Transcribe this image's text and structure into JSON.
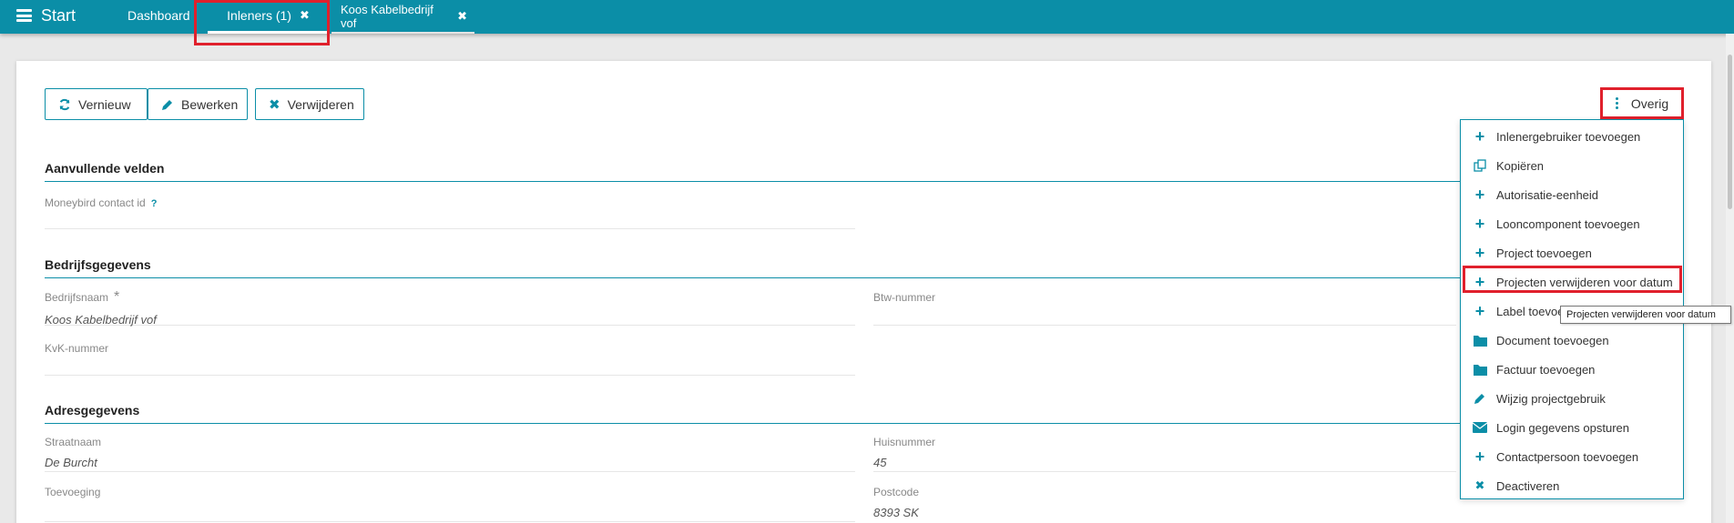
{
  "topbar": {
    "start_label": "Start",
    "tabs": [
      {
        "label": "Dashboard"
      },
      {
        "label": "Inleners (1)"
      },
      {
        "label": "Koos Kabelbedrijf vof"
      }
    ]
  },
  "toolbar": {
    "refresh_label": "Vernieuw",
    "edit_label": "Bewerken",
    "delete_label": "Verwijderen",
    "more_label": "Overig"
  },
  "sections": {
    "extra": "Aanvullende velden",
    "company": "Bedrijfsgegevens",
    "address": "Adresgegevens"
  },
  "fields": {
    "moneybird": {
      "label": "Moneybird contact id",
      "help": "?"
    },
    "bedrijfsnaam": {
      "label": "Bedrijfsnaam",
      "required": "*",
      "value": "Koos Kabelbedrijf vof"
    },
    "btw": {
      "label": "Btw-nummer"
    },
    "kvk": {
      "label": "KvK-nummer"
    },
    "straatnaam": {
      "label": "Straatnaam",
      "value": "De Burcht"
    },
    "huisnummer": {
      "label": "Huisnummer",
      "value": "45"
    },
    "toevoeging": {
      "label": "Toevoeging"
    },
    "postcode": {
      "label": "Postcode",
      "value": "8393 SK"
    }
  },
  "menu": {
    "items": [
      {
        "label": "Inlenergebruiker toevoegen",
        "icon": "plus-icon"
      },
      {
        "label": "Kopiëren",
        "icon": "copy-icon"
      },
      {
        "label": "Autorisatie-eenheid",
        "icon": "plus-icon"
      },
      {
        "label": "Looncomponent toevoegen",
        "icon": "plus-icon"
      },
      {
        "label": "Project toevoegen",
        "icon": "plus-icon"
      },
      {
        "label": "Projecten verwijderen voor datum",
        "icon": "plus-icon"
      },
      {
        "label": "Label toevoegen",
        "icon": "plus-icon"
      },
      {
        "label": "Document toevoegen",
        "icon": "folder-icon"
      },
      {
        "label": "Factuur toevoegen",
        "icon": "folder-icon"
      },
      {
        "label": "Wijzig projectgebruik",
        "icon": "pencil-icon"
      },
      {
        "label": "Login gegevens opsturen",
        "icon": "envelope-icon"
      },
      {
        "label": "Contactpersoon toevoegen",
        "icon": "plus-icon"
      },
      {
        "label": "Deactiveren",
        "icon": "close-icon"
      }
    ],
    "tooltip": "Projecten verwijderen voor datum"
  },
  "colors": {
    "accent": "#0b8ea7",
    "highlight": "#e0202c"
  }
}
